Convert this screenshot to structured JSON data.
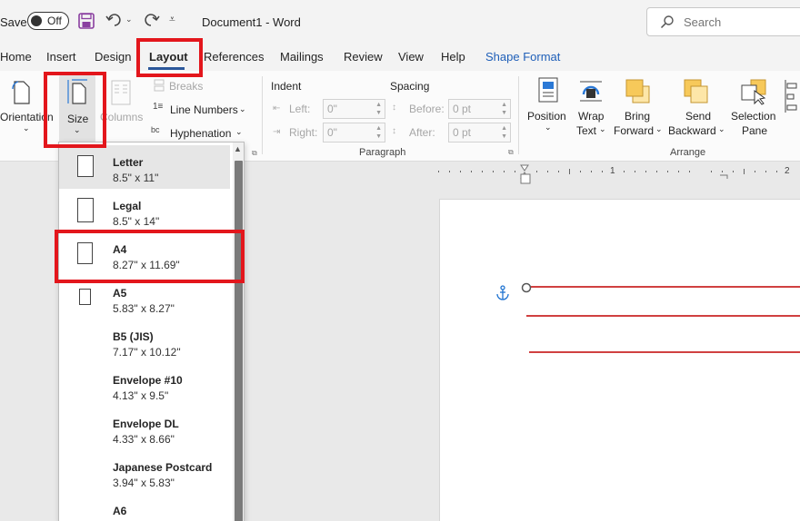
{
  "titlebar": {
    "autosave_label": "Save",
    "autosave_state": "Off",
    "document_title": "Document1  -  Word",
    "search_placeholder": "Search"
  },
  "tabs": [
    {
      "label": "Home"
    },
    {
      "label": "Insert"
    },
    {
      "label": "Design"
    },
    {
      "label": "Layout",
      "active": true
    },
    {
      "label": "References"
    },
    {
      "label": "Mailings"
    },
    {
      "label": "Review"
    },
    {
      "label": "View"
    },
    {
      "label": "Help"
    },
    {
      "label": "Shape Format"
    }
  ],
  "ribbon": {
    "orientation": "Orientation",
    "size": "Size",
    "columns": "Columns",
    "breaks": "Breaks",
    "line_numbers": "Line Numbers",
    "hyphenation": "Hyphenation",
    "indent": {
      "title": "Indent",
      "left_label": "Left:",
      "left_value": "0\"",
      "right_label": "Right:",
      "right_value": "0\""
    },
    "spacing": {
      "title": "Spacing",
      "before_label": "Before:",
      "before_value": "0 pt",
      "after_label": "After:",
      "after_value": "0 pt"
    },
    "paragraph_group": "Paragraph",
    "arrange_group": "Arrange",
    "position": "Position",
    "wrap_text": [
      "Wrap",
      "Text"
    ],
    "bring_forward": [
      "Bring",
      "Forward"
    ],
    "send_backward": [
      "Send",
      "Backward"
    ],
    "selection_pane": [
      "Selection",
      "Pane"
    ]
  },
  "ruler": {
    "marks": [
      "1",
      "2"
    ]
  },
  "size_menu": {
    "selected": "Letter",
    "items": [
      {
        "name": "Letter",
        "dims": "8.5\" x 11\""
      },
      {
        "name": "Legal",
        "dims": "8.5\" x 14\""
      },
      {
        "name": "A4",
        "dims": "8.27\" x 11.69\""
      },
      {
        "name": "A5",
        "dims": "5.83\" x 8.27\""
      },
      {
        "name": "B5 (JIS)",
        "dims": "7.17\" x 10.12\""
      },
      {
        "name": "Envelope #10",
        "dims": "4.13\" x 9.5\""
      },
      {
        "name": "Envelope DL",
        "dims": "4.33\" x 8.66\""
      },
      {
        "name": "Japanese Postcard",
        "dims": "3.94\" x 5.83\""
      },
      {
        "name": "A6",
        "dims": ""
      }
    ]
  },
  "colors": {
    "accent": "#2b579a",
    "highlight_box": "#e3161c",
    "doc_lines": "#c00000",
    "anchor": "#1f73d1"
  }
}
